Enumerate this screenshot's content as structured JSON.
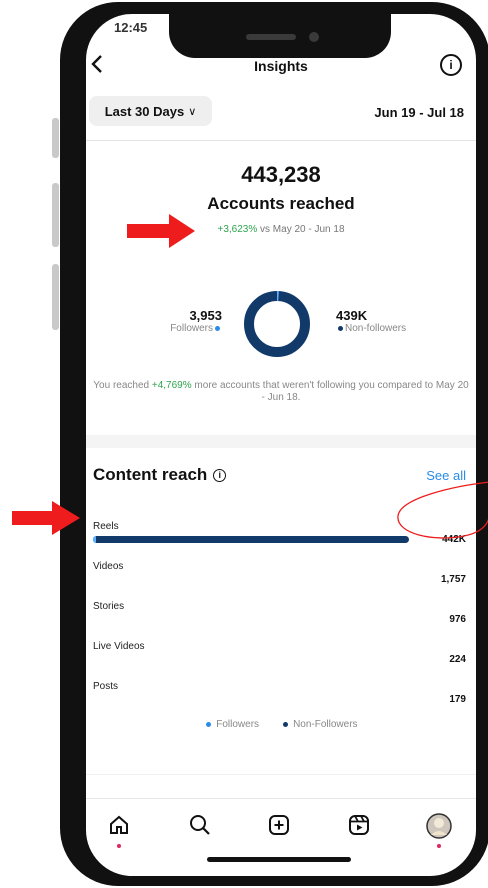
{
  "status": {
    "time": "12:45"
  },
  "header": {
    "back_icon": "chevron-left-icon",
    "title": "Insights",
    "info_icon": "info-icon"
  },
  "filter": {
    "period_label": "Last 30 Days",
    "caret": "∨",
    "date_range": "Jun 19 - Jul 18"
  },
  "summary": {
    "accounts_reached": "443,238",
    "label": "Accounts reached",
    "change": "+3,623%",
    "change_suffix": "vs May 20 - Jun 18"
  },
  "audience": {
    "followers_count": "3,953",
    "followers_label": "Followers",
    "non_followers_count": "439K",
    "non_followers_label": "Non-followers",
    "followers_share": 0.009,
    "note_prefix": "You reached",
    "note_pct": "+4,769%",
    "note_suffix": "more accounts that weren't following you compared to May 20 - Jun 18."
  },
  "content_reach": {
    "title": "Content reach",
    "see_all": "See all",
    "rows": [
      {
        "label": "Reels",
        "value": "442K",
        "fraction": 1.0
      },
      {
        "label": "Videos",
        "value": "1,757",
        "fraction": 0.004
      },
      {
        "label": "Stories",
        "value": "976",
        "fraction": 0.002
      },
      {
        "label": "Live Videos",
        "value": "224",
        "fraction": 0.0005
      },
      {
        "label": "Posts",
        "value": "179",
        "fraction": 0.0004
      }
    ],
    "legend_followers": "Followers",
    "legend_non_followers": "Non-Followers"
  },
  "bottom_nav": [
    "home-icon",
    "search-icon",
    "create-icon",
    "reels-icon",
    "profile-avatar"
  ],
  "colors": {
    "accent": "#2a8ce8",
    "bar_dark": "#113a6a",
    "followers_blue": "#5fb2ff",
    "positive": "#2ea44f",
    "annotation_red": "#ee1c1c"
  }
}
